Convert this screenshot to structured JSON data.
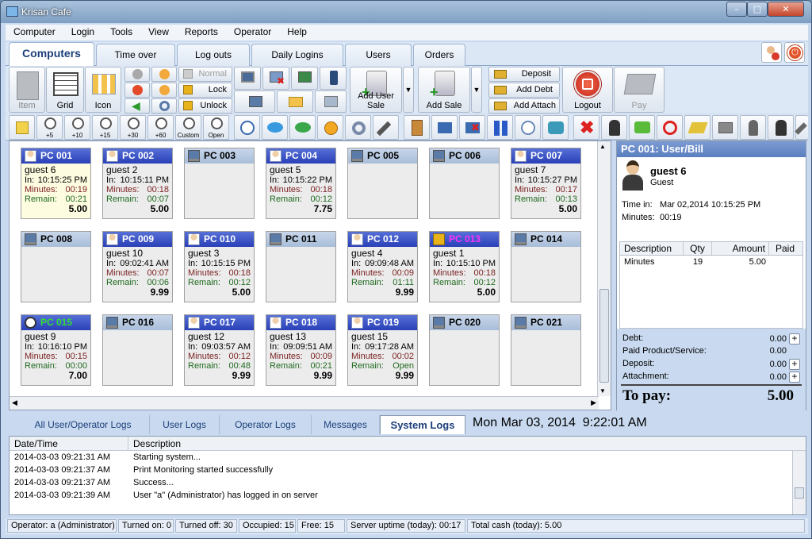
{
  "window": {
    "title": "Krisan Cafe"
  },
  "menu": [
    "Computer",
    "Login",
    "Tools",
    "View",
    "Reports",
    "Operator",
    "Help"
  ],
  "tabs": [
    "Computers",
    "Time over",
    "Log outs",
    "Daily Logins",
    "Users",
    "Orders"
  ],
  "toolbar": {
    "view_buttons": [
      "Item",
      "Grid",
      "Icon"
    ],
    "normal": "Normal",
    "lock": "Lock",
    "unlock": "Unlock",
    "add_user_sale": "Add User Sale",
    "add_sale": "Add Sale",
    "deposit": "Deposit",
    "add_debt": "Add Debt",
    "add_attach": "Add Attach",
    "logout": "Logout",
    "pay": "Pay",
    "time_buttons": [
      "+5",
      "+10",
      "+15",
      "+30",
      "+60",
      "Custom",
      "Open"
    ]
  },
  "pcs": [
    {
      "name": "PC 001",
      "state": "user",
      "sel": true,
      "guest": "guest 6",
      "in": "10:15:25 PM",
      "minutes": "00:19",
      "remain": "00:21",
      "amount": "5.00"
    },
    {
      "name": "PC 002",
      "state": "user",
      "guest": "guest 2",
      "in": "10:15:11 PM",
      "minutes": "00:18",
      "remain": "00:07",
      "amount": "5.00"
    },
    {
      "name": "PC 003",
      "state": "off"
    },
    {
      "name": "PC 004",
      "state": "user",
      "guest": "guest 5",
      "in": "10:15:22 PM",
      "minutes": "00:18",
      "remain": "00:12",
      "amount": "7.75"
    },
    {
      "name": "PC 005",
      "state": "off"
    },
    {
      "name": "PC 006",
      "state": "off"
    },
    {
      "name": "PC 007",
      "state": "user",
      "guest": "guest 7",
      "in": "10:15:27 PM",
      "minutes": "00:17",
      "remain": "00:13",
      "amount": "5.00"
    },
    {
      "name": "PC 008",
      "state": "off"
    },
    {
      "name": "PC 009",
      "state": "user",
      "guest": "guest 10",
      "in": "09:02:41 AM",
      "minutes": "00:07",
      "remain": "00:06",
      "amount": "9.99"
    },
    {
      "name": "PC 010",
      "state": "user",
      "guest": "guest 3",
      "in": "10:15:15 PM",
      "minutes": "00:18",
      "remain": "00:12",
      "amount": "5.00"
    },
    {
      "name": "PC 011",
      "state": "off"
    },
    {
      "name": "PC 012",
      "state": "user",
      "guest": "guest 4",
      "in": "09:09:48 AM",
      "minutes": "00:09",
      "remain": "01:11",
      "amount": "9.99"
    },
    {
      "name": "PC 013",
      "state": "locked",
      "guest": "guest 1",
      "in": "10:15:10 PM",
      "minutes": "00:18",
      "remain": "00:12",
      "amount": "5.00"
    },
    {
      "name": "PC 014",
      "state": "off"
    },
    {
      "name": "PC 015",
      "state": "timer",
      "guest": "guest 9",
      "in": "10:16:10 PM",
      "minutes": "00:15",
      "remain": "00:00",
      "amount": "7.00"
    },
    {
      "name": "PC 016",
      "state": "off"
    },
    {
      "name": "PC 017",
      "state": "user",
      "guest": "guest 12",
      "in": "09:03:57 AM",
      "minutes": "00:12",
      "remain": "00:48",
      "amount": "9.99"
    },
    {
      "name": "PC 018",
      "state": "user",
      "guest": "guest 13",
      "in": "09:09:51 AM",
      "minutes": "00:09",
      "remain": "00:21",
      "amount": "9.99"
    },
    {
      "name": "PC 019",
      "state": "user",
      "guest": "guest 15",
      "in": "09:17:28 AM",
      "minutes": "00:02",
      "remain": "Open",
      "amount": "9.99"
    },
    {
      "name": "PC 020",
      "state": "off"
    },
    {
      "name": "PC 021",
      "state": "off"
    }
  ],
  "labels": {
    "in": "In:",
    "minutes": "Minutes:",
    "remain": "Remain:"
  },
  "bill": {
    "header": "PC 001: User/Bill",
    "user": "guest 6",
    "role": "Guest",
    "time_in_label": "Time in:",
    "time_in": "Mar 02,2014 10:15:25 PM",
    "minutes_label": "Minutes:",
    "minutes": "00:19",
    "columns": [
      "Description",
      "Qty",
      "Amount",
      "Paid"
    ],
    "items": [
      {
        "desc": "Minutes",
        "qty": "19",
        "amount": "5.00",
        "paid": ""
      }
    ],
    "debt_label": "Debt:",
    "debt": "0.00",
    "pps_label": "Paid Product/Service:",
    "pps": "0.00",
    "deposit_label": "Deposit:",
    "deposit": "0.00",
    "attach_label": "Attachment:",
    "attach": "0.00",
    "topay_label": "To pay:",
    "topay": "5.00"
  },
  "log_tabs": [
    "All User/Operator Logs",
    "User Logs",
    "Operator Logs",
    "Messages",
    "System Logs"
  ],
  "clock": "Mon Mar 03, 2014  9:22:01 AM",
  "log_columns": [
    "Date/Time",
    "Description"
  ],
  "logs": [
    {
      "dt": "2014-03-03 09:21:31 AM",
      "desc": "Starting system..."
    },
    {
      "dt": "2014-03-03 09:21:37 AM",
      "desc": "Print Monitoring started successfully"
    },
    {
      "dt": "2014-03-03 09:21:37 AM",
      "desc": "Success..."
    },
    {
      "dt": "2014-03-03 09:21:39 AM",
      "desc": "User \"a\" (Administrator) has logged in on server"
    }
  ],
  "status": [
    "Operator: a (Administrator)",
    "Turned on: 0",
    "Turned off: 30",
    "Occupied: 15",
    "Free: 15",
    "Server uptime (today): 00:17",
    "Total cash (today): 5.00"
  ]
}
